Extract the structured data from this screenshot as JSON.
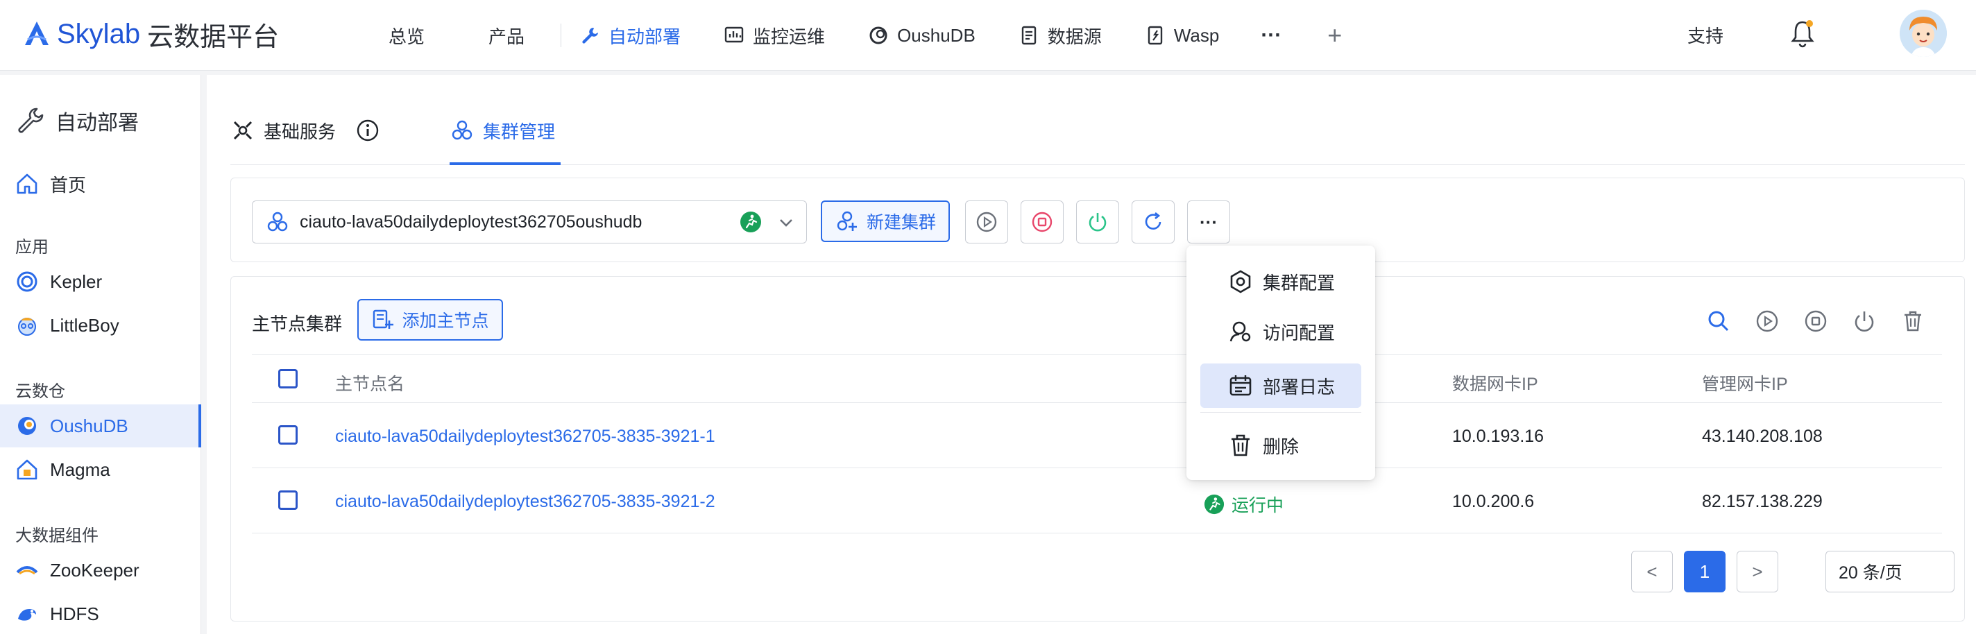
{
  "app": {
    "logo_text": "Skylab",
    "logo_sub": "云数据平台"
  },
  "nav": {
    "items": [
      {
        "label": "总览",
        "icon": "none"
      },
      {
        "label": "产品",
        "icon": "none"
      },
      {
        "label": "自动部署",
        "icon": "wrench-icon",
        "active": true
      },
      {
        "label": "监控运维",
        "icon": "monitor-chart-icon"
      },
      {
        "label": "OushuDB",
        "icon": "oushudb-icon"
      },
      {
        "label": "数据源",
        "icon": "document-icon"
      },
      {
        "label": "Wasp",
        "icon": "wasp-icon"
      }
    ],
    "more": "···",
    "plus": "+",
    "support": "支持"
  },
  "sidebar": {
    "title": "自动部署",
    "home": "首页",
    "groups": [
      {
        "label": "应用",
        "items": [
          "Kepler",
          "LittleBoy"
        ]
      },
      {
        "label": "云数仓",
        "items": [
          "OushuDB",
          "Magma"
        ]
      },
      {
        "label": "大数据组件",
        "items": [
          "ZooKeeper",
          "HDFS"
        ]
      }
    ],
    "active_item": "OushuDB"
  },
  "tabs": [
    {
      "label": "基础服务",
      "active": false
    },
    {
      "label": "集群管理",
      "active": true
    }
  ],
  "toolbar": {
    "cluster_name": "ciauto-lava50dailydeploytest362705oushudb",
    "new_cluster": "新建集群",
    "more": "···"
  },
  "dropdown": {
    "items": [
      {
        "label": "集群配置",
        "icon": "hex-nut-icon"
      },
      {
        "label": "访问配置",
        "icon": "user-gear-icon"
      },
      {
        "label": "部署日志",
        "icon": "calendar-log-icon",
        "hover": true
      },
      {
        "label": "删除",
        "icon": "trash-icon"
      }
    ]
  },
  "table": {
    "title": "主节点集群",
    "add_button": "添加主节点",
    "columns": [
      "主节点名",
      "数据网卡IP",
      "管理网卡IP"
    ],
    "rows": [
      {
        "name": "ciauto-lava50dailydeploytest362705-3835-3921-1",
        "status": "",
        "data_ip": "10.0.193.16",
        "mgmt_ip": "43.140.208.108"
      },
      {
        "name": "ciauto-lava50dailydeploytest362705-3835-3921-2",
        "status": "运行中",
        "data_ip": "10.0.200.6",
        "mgmt_ip": "82.157.138.229"
      }
    ]
  },
  "pagination": {
    "prev": "<",
    "current": "1",
    "next": ">",
    "page_size": "20 条/页"
  },
  "colors": {
    "primary": "#2b6be8",
    "success": "#18a058",
    "danger": "#e8476b",
    "power": "#2bc48a"
  }
}
